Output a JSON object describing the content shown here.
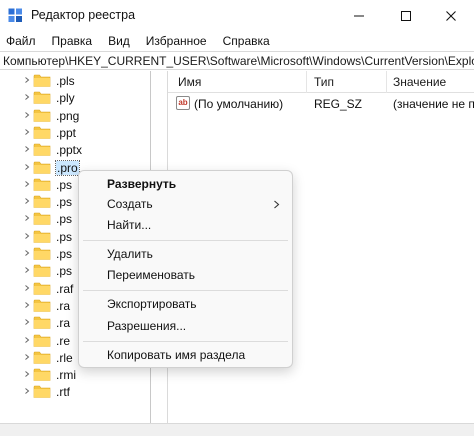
{
  "window": {
    "title": "Редактор реестра"
  },
  "menubar": [
    "Файл",
    "Правка",
    "Вид",
    "Избранное",
    "Справка"
  ],
  "address": "Компьютер\\HKEY_CURRENT_USER\\Software\\Microsoft\\Windows\\CurrentVersion\\Explorer\\F",
  "tree": {
    "items": [
      ".pls",
      ".ply",
      ".png",
      ".ppt",
      ".pptx",
      ".pro",
      ".ps",
      ".ps",
      ".ps",
      ".ps",
      ".ps",
      ".ps",
      ".raf",
      ".ra",
      ".ra",
      ".re",
      ".rle",
      ".rmi",
      ".rtf"
    ],
    "selected_index": 5
  },
  "list": {
    "columns": [
      "Имя",
      "Тип",
      "Значение"
    ],
    "rows": [
      {
        "name": "(По умолчанию)",
        "type": "REG_SZ",
        "value": "(значение не пр"
      }
    ]
  },
  "context_menu": {
    "items": [
      {
        "label": "Развернуть",
        "bold": true
      },
      {
        "label": "Создать",
        "submenu": true
      },
      {
        "label": "Найти..."
      },
      {
        "label": "Удалить"
      },
      {
        "label": "Переименовать"
      },
      {
        "label": "Экспортировать"
      },
      {
        "label": "Разрешения..."
      },
      {
        "label": "Копировать имя раздела"
      }
    ]
  },
  "colors": {
    "folder": "#f4c542",
    "selection": "#cce8ff",
    "app_icon": "#2b6fd6"
  }
}
